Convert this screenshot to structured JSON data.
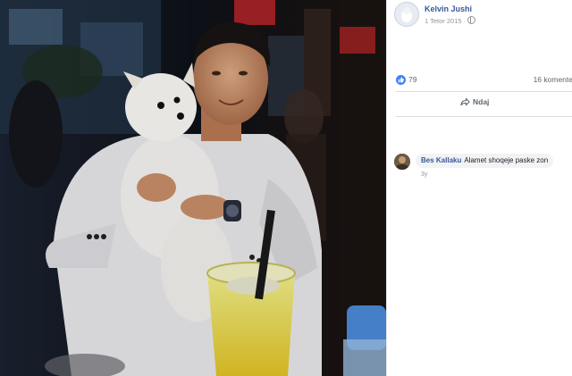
{
  "post": {
    "author": "Kelvin Jushi",
    "date": "1 Tetor 2015",
    "separator": "·",
    "privacy_icon": "globe-icon"
  },
  "stats": {
    "likes": "79",
    "comments": "16 komente",
    "reaction_icon": "like-icon"
  },
  "actions": {
    "share_label": "Ndaj",
    "share_icon": "share-arrow-icon"
  },
  "comments": [
    {
      "author": "Bes Kallaku",
      "text": "Alamet shoqeje paske zon",
      "time": "3y"
    }
  ],
  "colors": {
    "link": "#385898",
    "like_blue": "#4080ff",
    "muted": "#90949c",
    "bubble": "#f2f3f5"
  }
}
